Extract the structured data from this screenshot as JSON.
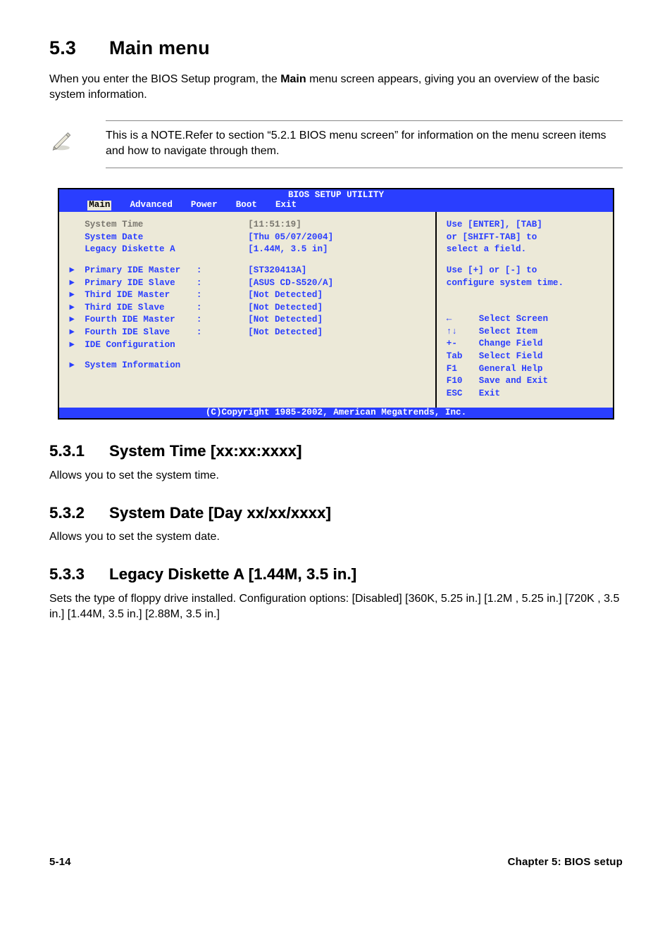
{
  "heading": {
    "num": "5.3",
    "title": "Main menu"
  },
  "intro_a": "When you enter the BIOS Setup program, the ",
  "intro_bold": "Main",
  "intro_b": " menu screen appears, giving you an overview of the basic system information.",
  "note": "This is a NOTE.Refer to section “5.2.1  BIOS menu screen” for information on the menu screen items and how to navigate through them.",
  "bios": {
    "title": "BIOS SETUP UTILITY",
    "tabs": [
      "Main",
      "Advanced",
      "Power",
      "Boot",
      "Exit"
    ],
    "top_rows": [
      {
        "label": "System Time",
        "value": "[11:51:19]",
        "dim": true
      },
      {
        "label": "System Date",
        "value": "[Thu 05/07/2004]"
      },
      {
        "label": "Legacy Diskette A",
        "value": "[1.44M, 3.5 in]"
      }
    ],
    "ide_rows": [
      {
        "label": "Primary IDE Master",
        "value": "[ST320413A]"
      },
      {
        "label": "Primary IDE Slave",
        "value": "[ASUS CD-S520/A]"
      },
      {
        "label": "Third IDE Master",
        "value": "[Not Detected]"
      },
      {
        "label": "Third IDE Slave",
        "value": "[Not Detected]"
      },
      {
        "label": "Fourth IDE Master",
        "value": "[Not Detected]"
      },
      {
        "label": "Fourth IDE Slave",
        "value": "[Not Detected]"
      },
      {
        "label": "IDE Configuration",
        "value": ""
      }
    ],
    "sys_info": "System Information",
    "help1": "Use [ENTER], [TAB]",
    "help2": "or [SHIFT-TAB] to",
    "help3": "select a field.",
    "help4": "Use [+] or [-] to",
    "help5": "configure system time.",
    "legend": [
      {
        "sym": "←",
        "txt": "Select Screen"
      },
      {
        "sym": "↑↓",
        "txt": "Select Item"
      },
      {
        "sym": "+-",
        "txt": "Change Field"
      },
      {
        "sym": "Tab",
        "txt": "Select Field"
      },
      {
        "sym": "F1",
        "txt": "General Help"
      },
      {
        "sym": "F10",
        "txt": "Save and Exit"
      },
      {
        "sym": "ESC",
        "txt": "Exit"
      }
    ],
    "footer": "(C)Copyright 1985-2002, American Megatrends, Inc."
  },
  "s531": {
    "num": "5.3.1",
    "title": "System Time [xx:xx:xxxx]",
    "body": "Allows you to set the system time."
  },
  "s532": {
    "num": "5.3.2",
    "title": "System Date [Day xx/xx/xxxx]",
    "body": "Allows you to set the system date."
  },
  "s533": {
    "num": "5.3.3",
    "title": "Legacy Diskette A [1.44M, 3.5 in.]",
    "body": "Sets the type of floppy drive installed. Configuration options: [Disabled] [360K, 5.25 in.] [1.2M , 5.25 in.] [720K , 3.5 in.] [1.44M, 3.5 in.] [2.88M, 3.5 in.]"
  },
  "footer": {
    "left": "5-14",
    "right": "Chapter 5: BIOS setup"
  }
}
